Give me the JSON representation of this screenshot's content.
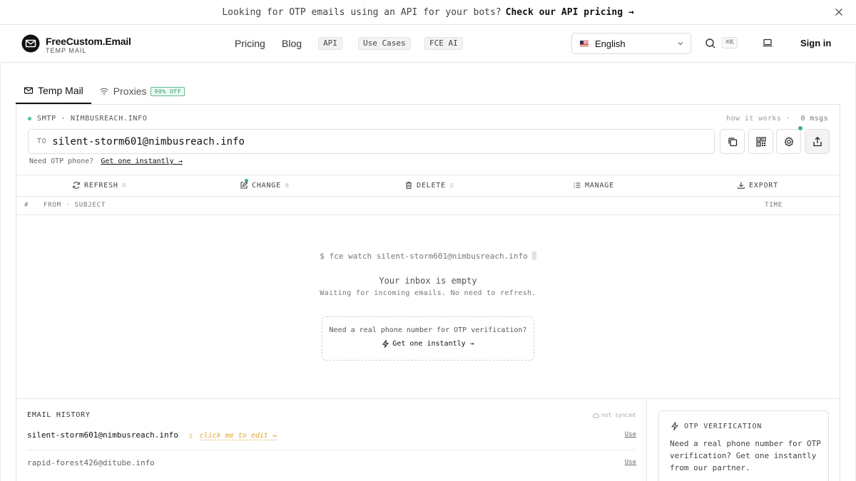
{
  "banner": {
    "text": "Looking for OTP emails using an API for your bots?",
    "link": "Check our API pricing →"
  },
  "header": {
    "brand_name": "FreeCustom.Email",
    "brand_sub": "TEMP MAIL",
    "nav": {
      "pricing": "Pricing",
      "blog": "Blog",
      "api": "API",
      "use_cases": "Use Cases",
      "fce_ai": "FCE AI"
    },
    "language": "English",
    "search_shortcut": "⌘K",
    "sign_in": "Sign in"
  },
  "tabs": {
    "temp_mail": "Temp Mail",
    "proxies": "Proxies",
    "proxies_badge": "90% OFF"
  },
  "mailbox": {
    "smtp_label": "SMTP · NIMBUSREACH.INFO",
    "how_it_works": "how it works ·",
    "msgs": "0 msgs",
    "to_label": "TO",
    "address": "silent-storm601@nimbusreach.info",
    "otp_hint": "Need OTP phone?",
    "otp_hint_link": "Get one instantly →"
  },
  "actions": {
    "refresh": "REFRESH",
    "refresh_key": "R",
    "change": "CHANGE",
    "change_key": "N",
    "delete": "DELETE",
    "delete_key": "D",
    "manage": "MANAGE",
    "export": "EXPORT"
  },
  "columns": {
    "hash": "#",
    "from_subject": "FROM · SUBJECT",
    "time": "TIME"
  },
  "empty": {
    "command": "$ fce watch silent-storm601@nimbusreach.info",
    "title": "Your inbox is empty",
    "subtitle": "Waiting for incoming emails. No need to refresh.",
    "promo_question": "Need a real phone number for OTP verification?",
    "promo_cta": "Get one instantly →"
  },
  "history": {
    "title": "EMAIL HISTORY",
    "sync_status": "not synced",
    "items": [
      {
        "email": "silent-storm601@nimbusreach.info",
        "edit": "click me to edit ✏",
        "action": "Use"
      },
      {
        "email": "rapid-forest426@ditube.info",
        "action": "Use"
      }
    ]
  },
  "otp_card": {
    "title": "OTP VERIFICATION",
    "body": "Need a real phone number for OTP verification? Get one instantly from our partner."
  },
  "colors": {
    "accent_green": "#3cb47a",
    "edit_amber": "#e0a52a"
  }
}
